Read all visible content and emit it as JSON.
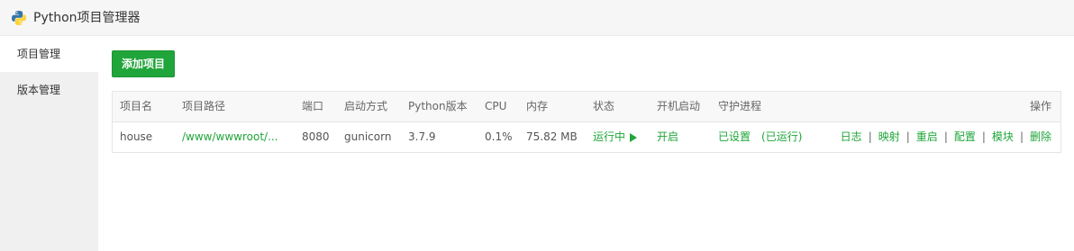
{
  "window": {
    "title": "Python项目管理器"
  },
  "sidebar": {
    "items": [
      {
        "label": "项目管理"
      },
      {
        "label": "版本管理"
      }
    ]
  },
  "toolbar": {
    "add_label": "添加项目"
  },
  "table": {
    "headers": {
      "name": "项目名",
      "path": "项目路径",
      "port": "端口",
      "start_mode": "启动方式",
      "python_version": "Python版本",
      "cpu": "CPU",
      "memory": "内存",
      "status": "状态",
      "autostart": "开机启动",
      "daemon": "守护进程",
      "actions": "操作"
    },
    "rows": [
      {
        "name": "house",
        "path": "/www/wwwroot/...",
        "port": "8080",
        "start_mode": "gunicorn",
        "python_version": "3.7.9",
        "cpu": "0.1%",
        "memory": "75.82 MB",
        "status": "运行中",
        "autostart": "开启",
        "daemon": "已设置",
        "daemon_state": "(已运行)",
        "actions": [
          "日志",
          "映射",
          "重启",
          "配置",
          "模块",
          "删除"
        ]
      }
    ]
  },
  "colors": {
    "accent": "#20a53a",
    "sidebar_bg": "#f0f0f0",
    "header_bg": "#f8f8f8"
  },
  "icons": {
    "app_logo": "python-logo-icon",
    "status": "play-icon"
  }
}
